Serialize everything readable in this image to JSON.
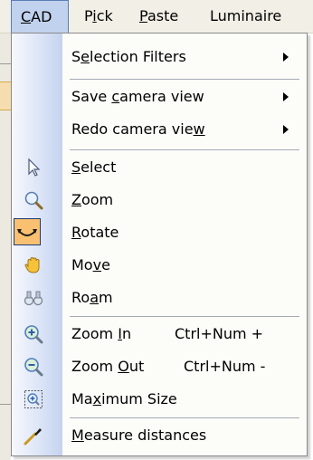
{
  "menubar": {
    "items": [
      {
        "label": "CAD",
        "mnemonic": "C",
        "active": true
      },
      {
        "label": "Pick",
        "mnemonic": "i"
      },
      {
        "label": "Paste",
        "mnemonic": "P"
      },
      {
        "label": "Luminaire",
        "mnemonic": ""
      }
    ]
  },
  "menu": {
    "items": [
      {
        "label_pre": "S",
        "label_u": "e",
        "label_post": "lection Filters",
        "submenu": true,
        "icon": "none"
      },
      {
        "label_pre": "Save ",
        "label_u": "c",
        "label_post": "amera view",
        "submenu": true,
        "icon": "none"
      },
      {
        "label_pre": "Redo camera vie",
        "label_u": "w",
        "label_post": "",
        "submenu": true,
        "icon": "none"
      },
      {
        "label_pre": "",
        "label_u": "S",
        "label_post": "elect",
        "icon": "arrow-cursor-icon"
      },
      {
        "label_pre": "",
        "label_u": "Z",
        "label_post": "oom",
        "icon": "magnifier-icon"
      },
      {
        "label_pre": "",
        "label_u": "R",
        "label_post": "otate",
        "icon": "rotate-icon",
        "checked": true
      },
      {
        "label_pre": "Mo",
        "label_u": "v",
        "label_post": "e",
        "icon": "hand-icon"
      },
      {
        "label_pre": "Ro",
        "label_u": "a",
        "label_post": "m",
        "icon": "binoculars-icon"
      },
      {
        "label_pre": "Zoom ",
        "label_u": "I",
        "label_post": "n",
        "shortcut": "Ctrl+Num +",
        "icon": "zoom-in-icon"
      },
      {
        "label_pre": "Zoom ",
        "label_u": "O",
        "label_post": "ut",
        "shortcut": "Ctrl+Num -",
        "icon": "zoom-out-icon"
      },
      {
        "label_pre": "Ma",
        "label_u": "x",
        "label_post": "imum Size",
        "icon": "zoom-extents-icon"
      },
      {
        "label_pre": "",
        "label_u": "M",
        "label_post": "easure distances",
        "icon": "measure-icon"
      }
    ]
  },
  "colors": {
    "menubar_bg": "#f1efe6",
    "active_menu_bg": "#c1d2ee",
    "checked_item_bg": "#f8c070",
    "icon_column": "#c4d3ee"
  }
}
